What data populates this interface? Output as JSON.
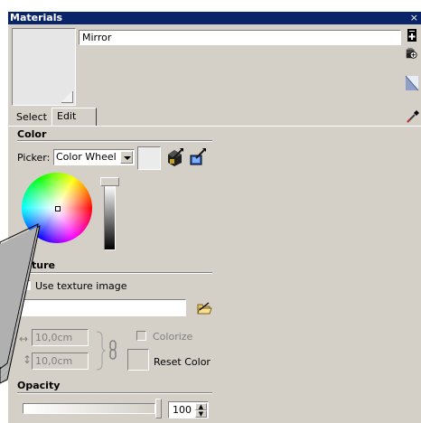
{
  "window": {
    "title": "Materials",
    "close_glyph": "×"
  },
  "material": {
    "name": "Mirror"
  },
  "tabs": [
    {
      "label": "Select"
    },
    {
      "label": "Edit"
    }
  ],
  "color": {
    "heading": "Color",
    "picker_label": "Picker:",
    "picker_value": "Color Wheel"
  },
  "texture": {
    "heading": "ture",
    "use_image_label": "Use texture image",
    "width": "10,0cm",
    "height": "10,0cm",
    "colorize_label": "Colorize",
    "reset_label": "Reset Color"
  },
  "opacity": {
    "heading": "Opacity",
    "value": "100"
  },
  "icons": {
    "create_material": "create-material-icon",
    "duplicate": "paint-stack-icon",
    "display_secondary": "secondary-pane-icon",
    "sample_paint": "eyedropper-icon",
    "match_model": "match-model-color-icon",
    "match_screen": "match-screen-color-icon",
    "browse_texture": "folder-icon",
    "link_aspect": "chain-link-icon"
  },
  "colors": {
    "titlebar": "#0a246a",
    "face": "#d4d0c8",
    "preview_swatch": "#e6e6e6"
  }
}
